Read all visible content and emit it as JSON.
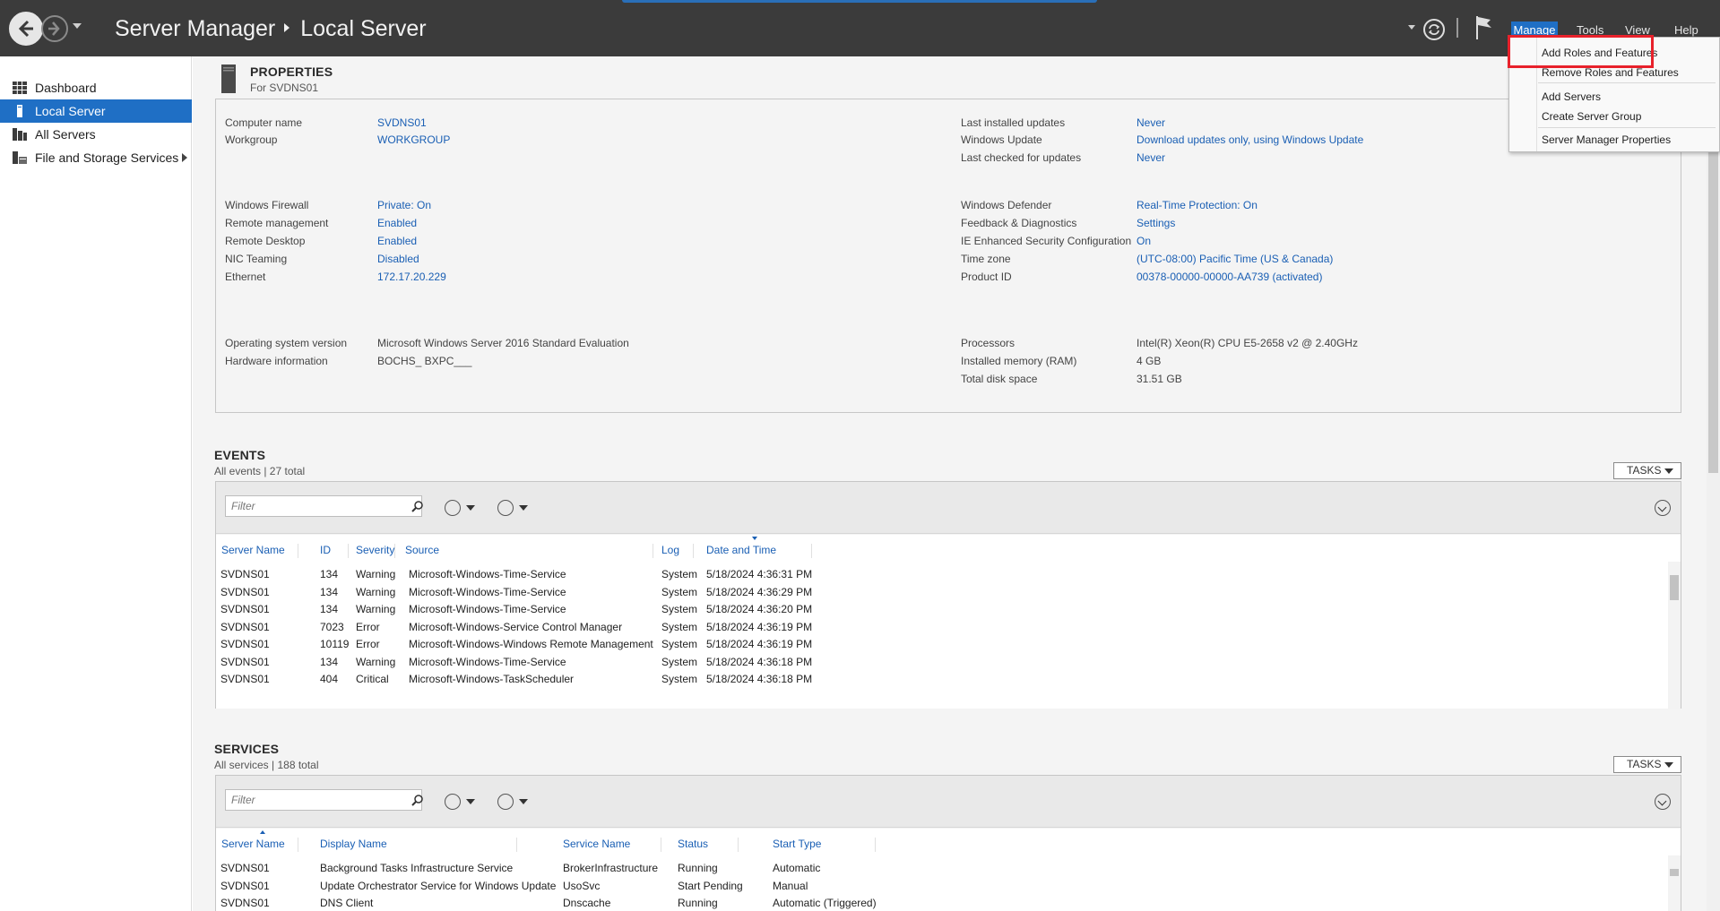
{
  "window": {
    "app": "Server Manager",
    "page": "Local Server"
  },
  "menubar": [
    "Manage",
    "Tools",
    "View",
    "Help"
  ],
  "manage_menu": {
    "items": [
      "Add Roles and Features",
      "Remove Roles and Features",
      "Add Servers",
      "Create Server Group",
      "Server Manager Properties"
    ]
  },
  "sidebar": {
    "items": [
      {
        "label": "Dashboard",
        "icon": "dashboard-icon"
      },
      {
        "label": "Local Server",
        "icon": "server-icon"
      },
      {
        "label": "All Servers",
        "icon": "servers-icon"
      },
      {
        "label": "File and Storage Services",
        "icon": "storage-icon"
      }
    ],
    "active": "Local Server"
  },
  "properties": {
    "title": "PROPERTIES",
    "subtitle": "For SVDNS01",
    "left": [
      {
        "label": "Computer name",
        "value": "SVDNS01"
      },
      {
        "label": "Workgroup",
        "value": "WORKGROUP"
      },
      {
        "label": "Windows Firewall",
        "value": "Private: On"
      },
      {
        "label": "Remote management",
        "value": "Enabled"
      },
      {
        "label": "Remote Desktop",
        "value": "Enabled"
      },
      {
        "label": "NIC Teaming",
        "value": "Disabled"
      },
      {
        "label": "Ethernet",
        "value": "172.17.20.229"
      },
      {
        "label": "Operating system version",
        "value": "Microsoft Windows Server 2016 Standard Evaluation"
      },
      {
        "label": "Hardware information",
        "value": "BOCHS_ BXPC___"
      }
    ],
    "right": [
      {
        "label": "Last installed updates",
        "value": "Never"
      },
      {
        "label": "Windows Update",
        "value": "Download updates only, using Windows Update"
      },
      {
        "label": "Last checked for updates",
        "value": "Never"
      },
      {
        "label": "Windows Defender",
        "value": "Real-Time Protection: On"
      },
      {
        "label": "Feedback & Diagnostics",
        "value": "Settings"
      },
      {
        "label": "IE Enhanced Security Configuration",
        "value": "On"
      },
      {
        "label": "Time zone",
        "value": "(UTC-08:00) Pacific Time (US & Canada)"
      },
      {
        "label": "Product ID",
        "value": "00378-00000-00000-AA739 (activated)"
      },
      {
        "label": "Processors",
        "value": "Intel(R) Xeon(R) CPU E5-2658 v2 @ 2.40GHz"
      },
      {
        "label": "Installed memory (RAM)",
        "value": "4 GB"
      },
      {
        "label": "Total disk space",
        "value": "31.51 GB"
      }
    ]
  },
  "events": {
    "title": "EVENTS",
    "subtitle": "All events | 27 total",
    "tasks": "TASKS",
    "filter_placeholder": "Filter",
    "columns": [
      "Server Name",
      "ID",
      "Severity",
      "Source",
      "Log",
      "Date and Time"
    ],
    "rows": [
      [
        "SVDNS01",
        "134",
        "Warning",
        "Microsoft-Windows-Time-Service",
        "System",
        "5/18/2024 4:36:31 PM"
      ],
      [
        "SVDNS01",
        "134",
        "Warning",
        "Microsoft-Windows-Time-Service",
        "System",
        "5/18/2024 4:36:29 PM"
      ],
      [
        "SVDNS01",
        "134",
        "Warning",
        "Microsoft-Windows-Time-Service",
        "System",
        "5/18/2024 4:36:20 PM"
      ],
      [
        "SVDNS01",
        "7023",
        "Error",
        "Microsoft-Windows-Service Control Manager",
        "System",
        "5/18/2024 4:36:19 PM"
      ],
      [
        "SVDNS01",
        "10119",
        "Error",
        "Microsoft-Windows-Windows Remote Management",
        "System",
        "5/18/2024 4:36:19 PM"
      ],
      [
        "SVDNS01",
        "134",
        "Warning",
        "Microsoft-Windows-Time-Service",
        "System",
        "5/18/2024 4:36:18 PM"
      ],
      [
        "SVDNS01",
        "404",
        "Critical",
        "Microsoft-Windows-TaskScheduler",
        "System",
        "5/18/2024 4:36:18 PM"
      ]
    ]
  },
  "services": {
    "title": "SERVICES",
    "subtitle": "All services | 188 total",
    "tasks": "TASKS",
    "filter_placeholder": "Filter",
    "columns": [
      "Server Name",
      "Display Name",
      "Service Name",
      "Status",
      "Start Type"
    ],
    "rows": [
      [
        "SVDNS01",
        "Background Tasks Infrastructure Service",
        "BrokerInfrastructure",
        "Running",
        "Automatic"
      ],
      [
        "SVDNS01",
        "Update Orchestrator Service for Windows Update",
        "UsoSvc",
        "Start Pending",
        "Manual"
      ],
      [
        "SVDNS01",
        "DNS Client",
        "Dnscache",
        "Running",
        "Automatic (Triggered)"
      ]
    ]
  },
  "colors": {
    "titlebar": "#3b3b3b",
    "accent": "#1f6fc5",
    "link": "#1a5fb4",
    "highlight": "#e8212b"
  }
}
